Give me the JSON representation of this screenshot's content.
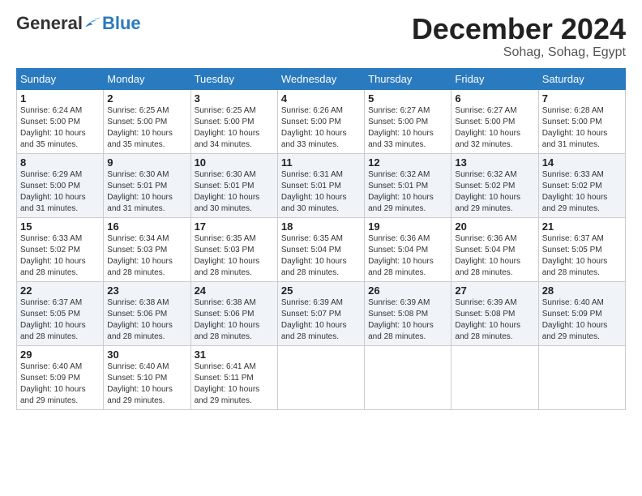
{
  "logo": {
    "general": "General",
    "blue": "Blue"
  },
  "header": {
    "month": "December 2024",
    "location": "Sohag, Sohag, Egypt"
  },
  "days_of_week": [
    "Sunday",
    "Monday",
    "Tuesday",
    "Wednesday",
    "Thursday",
    "Friday",
    "Saturday"
  ],
  "weeks": [
    [
      {
        "day": "1",
        "detail": "Sunrise: 6:24 AM\nSunset: 5:00 PM\nDaylight: 10 hours\nand 35 minutes."
      },
      {
        "day": "2",
        "detail": "Sunrise: 6:25 AM\nSunset: 5:00 PM\nDaylight: 10 hours\nand 35 minutes."
      },
      {
        "day": "3",
        "detail": "Sunrise: 6:25 AM\nSunset: 5:00 PM\nDaylight: 10 hours\nand 34 minutes."
      },
      {
        "day": "4",
        "detail": "Sunrise: 6:26 AM\nSunset: 5:00 PM\nDaylight: 10 hours\nand 33 minutes."
      },
      {
        "day": "5",
        "detail": "Sunrise: 6:27 AM\nSunset: 5:00 PM\nDaylight: 10 hours\nand 33 minutes."
      },
      {
        "day": "6",
        "detail": "Sunrise: 6:27 AM\nSunset: 5:00 PM\nDaylight: 10 hours\nand 32 minutes."
      },
      {
        "day": "7",
        "detail": "Sunrise: 6:28 AM\nSunset: 5:00 PM\nDaylight: 10 hours\nand 31 minutes."
      }
    ],
    [
      {
        "day": "8",
        "detail": "Sunrise: 6:29 AM\nSunset: 5:00 PM\nDaylight: 10 hours\nand 31 minutes."
      },
      {
        "day": "9",
        "detail": "Sunrise: 6:30 AM\nSunset: 5:01 PM\nDaylight: 10 hours\nand 31 minutes."
      },
      {
        "day": "10",
        "detail": "Sunrise: 6:30 AM\nSunset: 5:01 PM\nDaylight: 10 hours\nand 30 minutes."
      },
      {
        "day": "11",
        "detail": "Sunrise: 6:31 AM\nSunset: 5:01 PM\nDaylight: 10 hours\nand 30 minutes."
      },
      {
        "day": "12",
        "detail": "Sunrise: 6:32 AM\nSunset: 5:01 PM\nDaylight: 10 hours\nand 29 minutes."
      },
      {
        "day": "13",
        "detail": "Sunrise: 6:32 AM\nSunset: 5:02 PM\nDaylight: 10 hours\nand 29 minutes."
      },
      {
        "day": "14",
        "detail": "Sunrise: 6:33 AM\nSunset: 5:02 PM\nDaylight: 10 hours\nand 29 minutes."
      }
    ],
    [
      {
        "day": "15",
        "detail": "Sunrise: 6:33 AM\nSunset: 5:02 PM\nDaylight: 10 hours\nand 28 minutes."
      },
      {
        "day": "16",
        "detail": "Sunrise: 6:34 AM\nSunset: 5:03 PM\nDaylight: 10 hours\nand 28 minutes."
      },
      {
        "day": "17",
        "detail": "Sunrise: 6:35 AM\nSunset: 5:03 PM\nDaylight: 10 hours\nand 28 minutes."
      },
      {
        "day": "18",
        "detail": "Sunrise: 6:35 AM\nSunset: 5:04 PM\nDaylight: 10 hours\nand 28 minutes."
      },
      {
        "day": "19",
        "detail": "Sunrise: 6:36 AM\nSunset: 5:04 PM\nDaylight: 10 hours\nand 28 minutes."
      },
      {
        "day": "20",
        "detail": "Sunrise: 6:36 AM\nSunset: 5:04 PM\nDaylight: 10 hours\nand 28 minutes."
      },
      {
        "day": "21",
        "detail": "Sunrise: 6:37 AM\nSunset: 5:05 PM\nDaylight: 10 hours\nand 28 minutes."
      }
    ],
    [
      {
        "day": "22",
        "detail": "Sunrise: 6:37 AM\nSunset: 5:05 PM\nDaylight: 10 hours\nand 28 minutes."
      },
      {
        "day": "23",
        "detail": "Sunrise: 6:38 AM\nSunset: 5:06 PM\nDaylight: 10 hours\nand 28 minutes."
      },
      {
        "day": "24",
        "detail": "Sunrise: 6:38 AM\nSunset: 5:06 PM\nDaylight: 10 hours\nand 28 minutes."
      },
      {
        "day": "25",
        "detail": "Sunrise: 6:39 AM\nSunset: 5:07 PM\nDaylight: 10 hours\nand 28 minutes."
      },
      {
        "day": "26",
        "detail": "Sunrise: 6:39 AM\nSunset: 5:08 PM\nDaylight: 10 hours\nand 28 minutes."
      },
      {
        "day": "27",
        "detail": "Sunrise: 6:39 AM\nSunset: 5:08 PM\nDaylight: 10 hours\nand 28 minutes."
      },
      {
        "day": "28",
        "detail": "Sunrise: 6:40 AM\nSunset: 5:09 PM\nDaylight: 10 hours\nand 29 minutes."
      }
    ],
    [
      {
        "day": "29",
        "detail": "Sunrise: 6:40 AM\nSunset: 5:09 PM\nDaylight: 10 hours\nand 29 minutes."
      },
      {
        "day": "30",
        "detail": "Sunrise: 6:40 AM\nSunset: 5:10 PM\nDaylight: 10 hours\nand 29 minutes."
      },
      {
        "day": "31",
        "detail": "Sunrise: 6:41 AM\nSunset: 5:11 PM\nDaylight: 10 hours\nand 29 minutes."
      },
      {
        "day": "",
        "detail": ""
      },
      {
        "day": "",
        "detail": ""
      },
      {
        "day": "",
        "detail": ""
      },
      {
        "day": "",
        "detail": ""
      }
    ]
  ]
}
